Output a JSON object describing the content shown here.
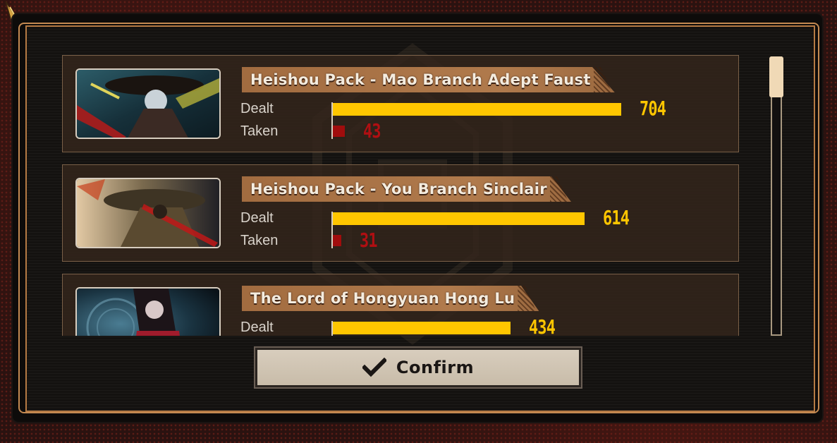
{
  "dialog": {
    "confirm_label": "Confirm"
  },
  "labels": {
    "dealt": "Dealt",
    "taken": "Taken"
  },
  "max_value": 704,
  "colors": {
    "dealt_bar": "#ffc600",
    "taken_bar": "#a00d0d",
    "frame_accent": "#c48a52",
    "name_tag": "#a26c40"
  },
  "entries": [
    {
      "name": "Heishou Pack - Mao Branch Adept Faust",
      "portrait_icon": "portrait-faust",
      "dealt": 704,
      "taken": 43,
      "dealt_text": "704",
      "taken_text": "43"
    },
    {
      "name": "Heishou Pack - You Branch Sinclair",
      "portrait_icon": "portrait-sinclair",
      "dealt": 614,
      "taken": 31,
      "dealt_text": "614",
      "taken_text": "31"
    },
    {
      "name": "The Lord of Hongyuan Hong Lu",
      "portrait_icon": "portrait-hong-lu",
      "dealt": 434,
      "taken": null,
      "dealt_text": "434",
      "taken_text": ""
    }
  ],
  "scrollbar": {
    "position_fraction": 0.0
  }
}
